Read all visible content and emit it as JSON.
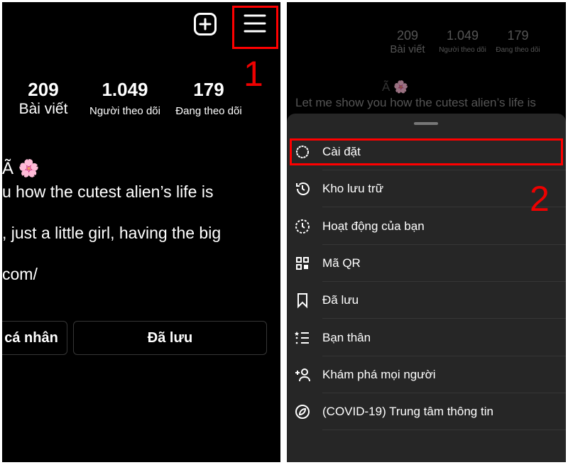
{
  "profile": {
    "stats": [
      {
        "value": "209",
        "label": "Bài viết"
      },
      {
        "value": "1.049",
        "label": "Người theo dõi"
      },
      {
        "value": "179",
        "label": "Đang theo dõi"
      }
    ],
    "name": "Ã 🌸",
    "bio_left": [
      "u how the cutest alien’s life is",
      ", just a little girl, having the big",
      "com/"
    ],
    "bio_right": "Let me show you how the cutest alien’s life is",
    "buttons": {
      "edit": "cá nhân",
      "saved": "Đã lưu"
    }
  },
  "annotations": {
    "step1": "1",
    "step2": "2",
    "highlight_color": "#ff0000"
  },
  "menu": {
    "items": [
      {
        "label": "Cài đặt",
        "icon": "settings-icon"
      },
      {
        "label": "Kho lưu trữ",
        "icon": "archive-icon"
      },
      {
        "label": "Hoạt động của bạn",
        "icon": "activity-icon"
      },
      {
        "label": "Mã QR",
        "icon": "qr-code-icon"
      },
      {
        "label": "Đã lưu",
        "icon": "bookmark-icon"
      },
      {
        "label": "Bạn thân",
        "icon": "close-friends-icon"
      },
      {
        "label": "Khám phá mọi người",
        "icon": "add-person-icon"
      },
      {
        "label": "(COVID-19) Trung tâm thông tin",
        "icon": "covid-info-icon"
      }
    ]
  }
}
